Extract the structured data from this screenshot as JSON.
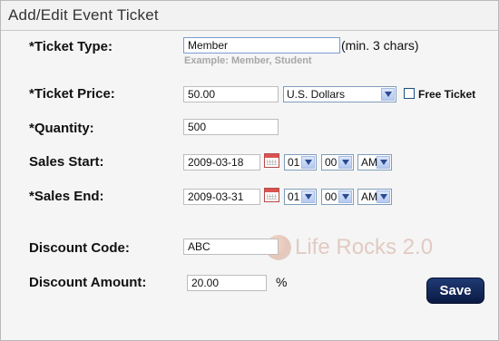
{
  "dialog": {
    "title": "Add/Edit Event Ticket"
  },
  "ticket_type": {
    "label": "*Ticket Type:",
    "value": "Member",
    "note": "(min. 3 chars)",
    "hint": "Example: Member, Student"
  },
  "ticket_price": {
    "label": "*Ticket Price:",
    "value": "50.00",
    "currency": "U.S. Dollars",
    "free_ticket_label": "Free Ticket",
    "free_ticket_checked": false
  },
  "quantity": {
    "label": "*Quantity:",
    "value": "500"
  },
  "sales_start": {
    "label": "Sales Start:",
    "date": "2009-03-18",
    "hour": "01",
    "minute": "00",
    "ampm": "AM"
  },
  "sales_end": {
    "label": "*Sales End:",
    "date": "2009-03-31",
    "hour": "01",
    "minute": "00",
    "ampm": "AM"
  },
  "discount_code": {
    "label": "Discount Code:",
    "value": "ABC"
  },
  "discount_amount": {
    "label": "Discount Amount:",
    "value": "20.00",
    "unit": "%"
  },
  "watermark": {
    "text": "Life Rocks 2.0"
  },
  "buttons": {
    "save": "Save"
  },
  "icons": {
    "calendar": "calendar-icon",
    "dropdown": "chevron-down-icon"
  },
  "colors": {
    "save_button": "#0f2352",
    "calendar_accent": "#d9534f",
    "select_border": "#7f9db9"
  }
}
